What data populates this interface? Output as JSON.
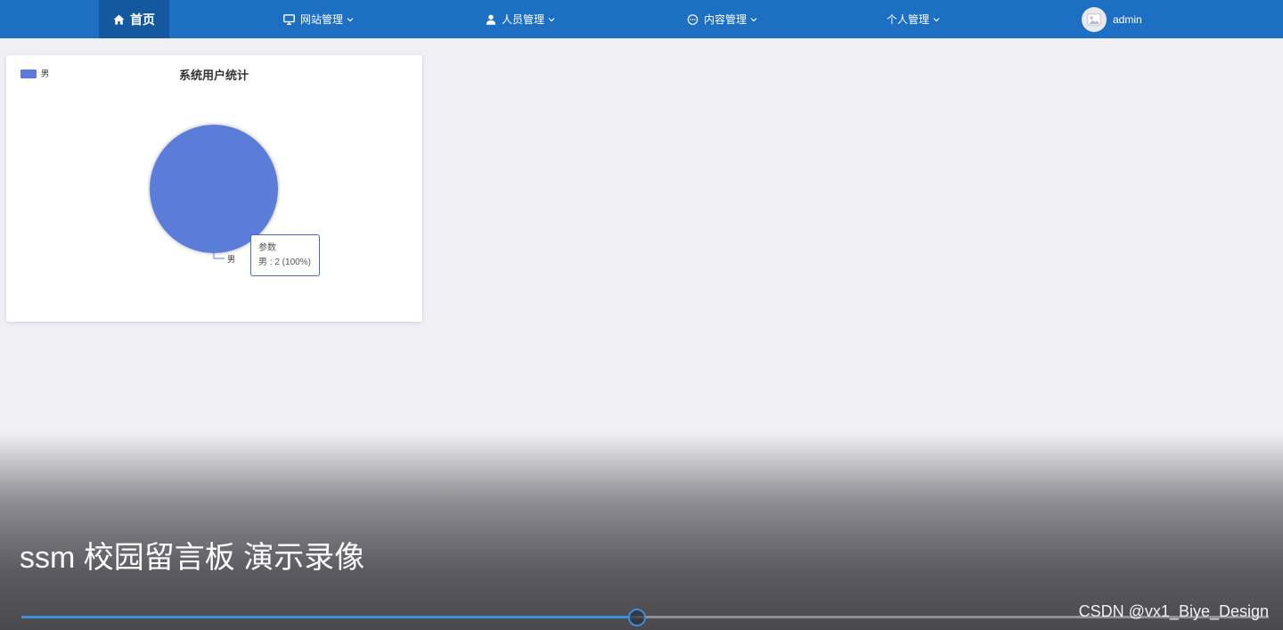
{
  "nav": {
    "home_label": "首页",
    "menus": [
      {
        "label": "网站管理",
        "icon": "monitor-icon"
      },
      {
        "label": "人员管理",
        "icon": "user-icon"
      },
      {
        "label": "内容管理",
        "icon": "chat-icon"
      },
      {
        "label": "个人管理",
        "icon": ""
      }
    ],
    "user": {
      "name": "admin",
      "avatar_icon": "image-placeholder-icon"
    },
    "colors": {
      "bar": "#1d6fc4",
      "active": "#14589f"
    }
  },
  "chart_data": {
    "type": "pie",
    "title": "系统用户统计",
    "legend": {
      "position": "top-left",
      "entries": [
        "男"
      ]
    },
    "slices": [
      {
        "name": "男",
        "value": 2,
        "percent": 100,
        "color": "#5b7bd9"
      }
    ],
    "tooltip": {
      "title": "参数",
      "line": "男 : 2 (100%)"
    }
  },
  "video": {
    "title": "ssm 校园留言板 演示录像",
    "progress_fraction": 0.4929,
    "watermark": "CSDN @vx1_Biye_Design"
  }
}
